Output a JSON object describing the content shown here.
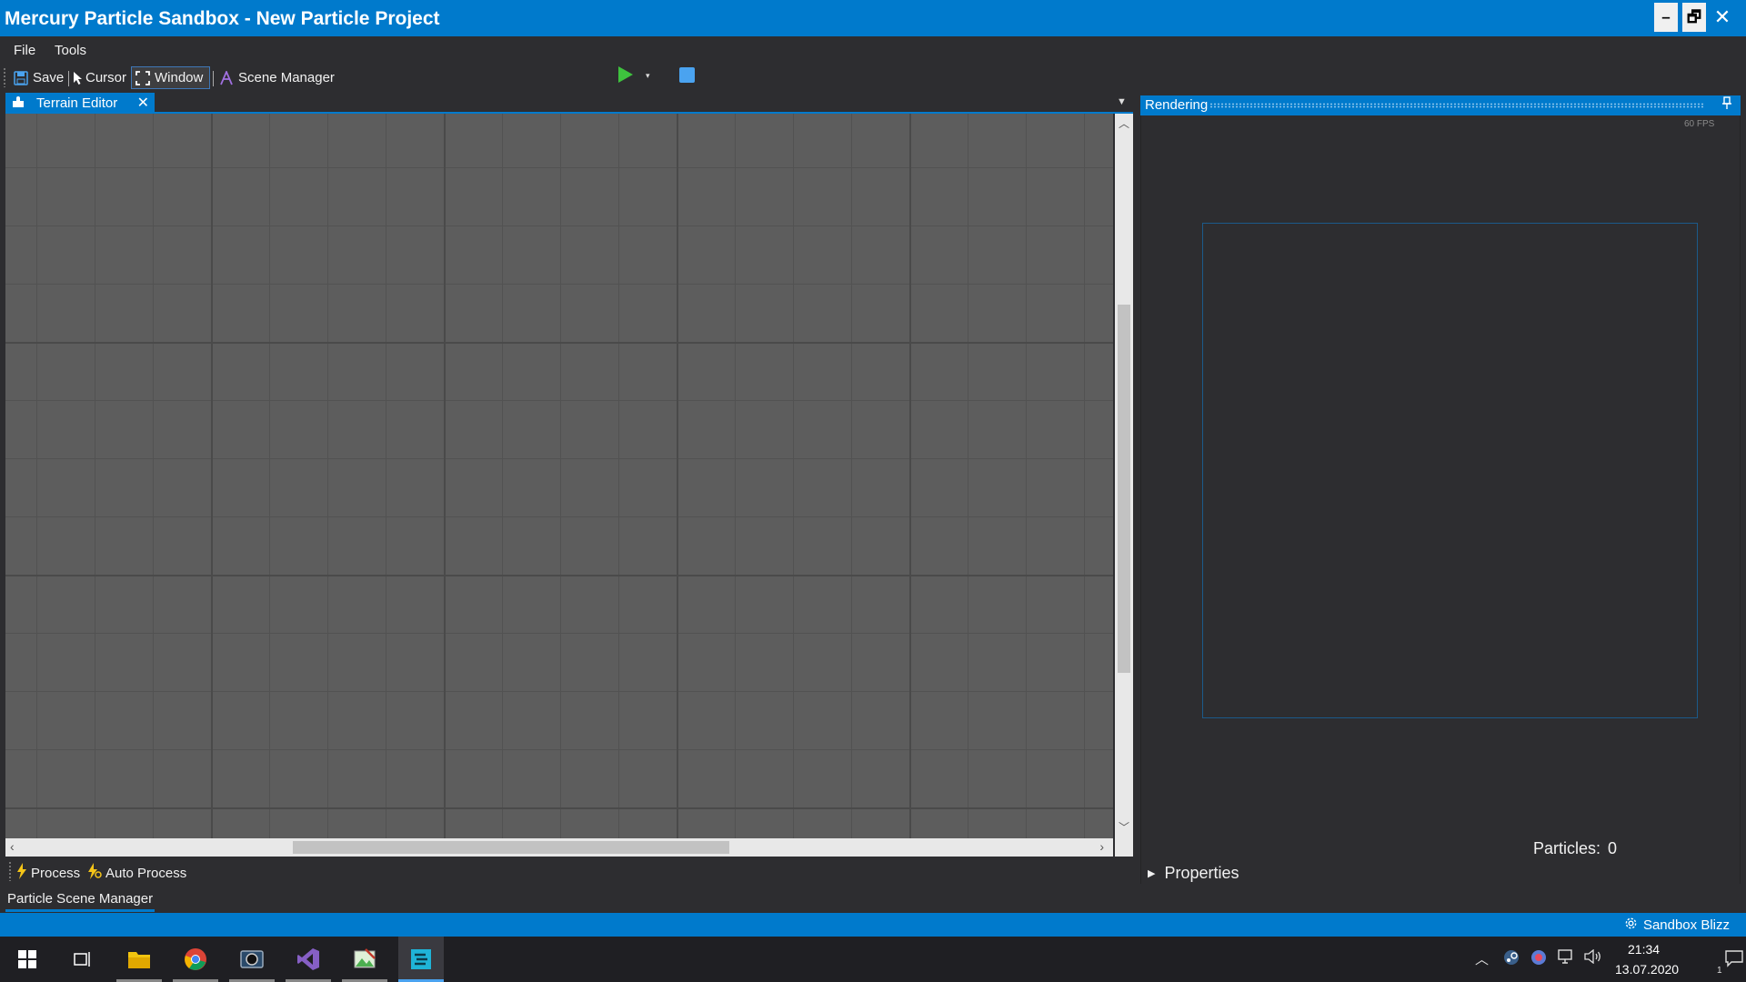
{
  "window": {
    "title": "Mercury Particle Sandbox - New Particle Project",
    "min_glyph": "–",
    "max_glyph": "🗗",
    "close_glyph": "✕"
  },
  "menu": {
    "file": "File",
    "tools": "Tools"
  },
  "toolbar": {
    "save": "Save",
    "cursor": "Cursor",
    "window": "Window",
    "scene_manager": "Scene Manager"
  },
  "editor": {
    "tab_label": "Terrain Editor",
    "tab_close": "✕",
    "process": "Process",
    "auto_process": "Auto Process",
    "bottom_tab": "Particle Scene Manager"
  },
  "rendering": {
    "title": "Rendering",
    "fps": "60 FPS",
    "particles_label": "Particles:",
    "particles_value": "0",
    "properties": "Properties"
  },
  "status": {
    "text": "Sandbox Blizz"
  },
  "taskbar": {
    "time": "21:34",
    "date": "13.07.2020",
    "notification_count": "1"
  },
  "colors": {
    "accent": "#007acc",
    "background": "#2d2d30",
    "grid": "#5d5d5d",
    "play": "#3ec23e",
    "stop": "#4aa3f0"
  }
}
